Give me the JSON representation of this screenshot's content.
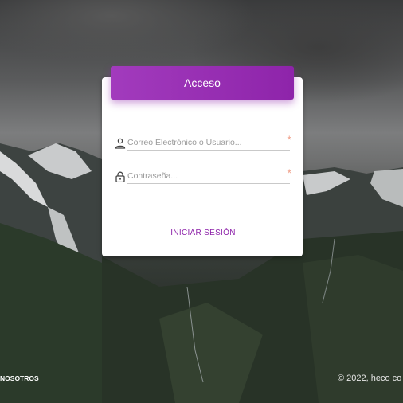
{
  "login": {
    "title": "Acceso",
    "username_placeholder": "Correo Electrónico o Usuario...",
    "password_placeholder": "Contraseña...",
    "required_mark": "*",
    "submit_label": "INICIAR SESIÓN"
  },
  "footer": {
    "about_link": "E NOSOTROS",
    "copyright": "© 2022, heco co"
  },
  "colors": {
    "accent": "#8e24aa",
    "required": "#f0a08a"
  },
  "icons": {
    "username": "user-icon",
    "password": "lock-icon"
  }
}
